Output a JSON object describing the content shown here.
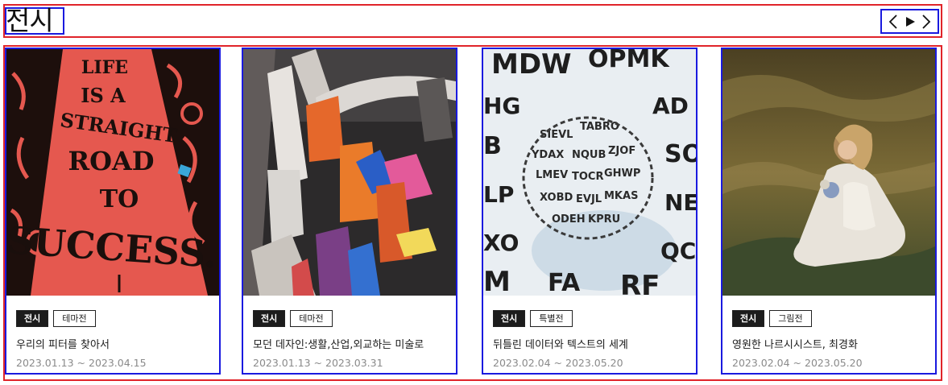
{
  "section": {
    "title": "전시"
  },
  "nav": {
    "prev_icon": "chevron-left-icon",
    "play_icon": "play-icon",
    "next_icon": "chevron-right-icon"
  },
  "cards": [
    {
      "category": "전시",
      "type": "테마전",
      "title": "우리의 피터를 찾아서",
      "period": "2023.01.13 ~ 2023.04.15",
      "poster_text": [
        "LIFE",
        "IS A",
        "STRAIGHT",
        "ROAD",
        "TO",
        "SUCCESS."
      ]
    },
    {
      "category": "전시",
      "type": "테마전",
      "title": "모던 데자인:생활,산업,외교하는 미술로",
      "period": "2023.01.13 ~ 2023.03.31"
    },
    {
      "category": "전시",
      "type": "특별전",
      "title": "뒤틀린 데이터와 텍스트의 세계",
      "period": "2023.02.04 ~ 2023.05.20"
    },
    {
      "category": "전시",
      "type": "그림전",
      "title": "영원한 나르시시스트, 최경화",
      "period": "2023.02.04 ~ 2023.05.20"
    }
  ],
  "colors": {
    "outer_frame": "#e0242a",
    "inner_frame": "#1a1adf",
    "tag_primary_bg": "#1c1c1c",
    "date_text": "#8a8a8a"
  }
}
